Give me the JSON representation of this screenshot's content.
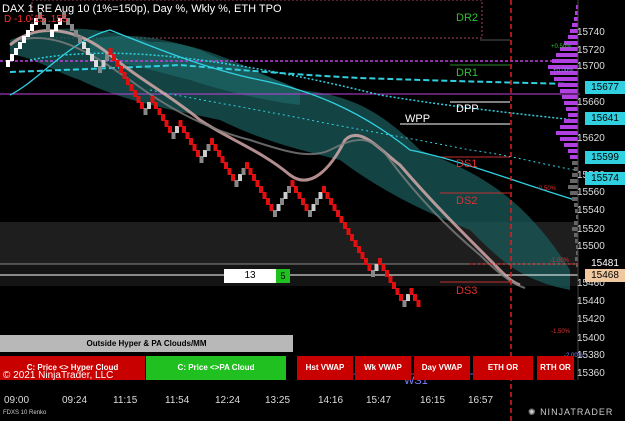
{
  "header": {
    "title": "DAX 1",
    "title_tail": "RE Aug 10 (1%=150p), Day %, Wkly %, ETH TPO",
    "sub": "D -1.0  15 .155"
  },
  "levels": {
    "dr2": "DR2",
    "dr1": "DR1",
    "dpp": "DPP",
    "wpp": "WPP",
    "ds1": "DS1",
    "ds2": "DS2",
    "ds3": "DS3",
    "ws1": "WS1"
  },
  "price_axis": {
    "ticks": [
      "15740",
      "15720",
      "15700",
      "15660",
      "15620",
      "15580",
      "15560",
      "15540",
      "15520",
      "15500",
      "15460",
      "15440",
      "15420",
      "15400",
      "15380",
      "15360"
    ],
    "boxes": [
      {
        "text": "15677",
        "bg": "#30d0e0",
        "fg": "#000"
      },
      {
        "text": "15641",
        "bg": "#30d0e0",
        "fg": "#000"
      },
      {
        "text": "15599",
        "bg": "#30d0e0",
        "fg": "#000"
      },
      {
        "text": "15574",
        "bg": "#30d0e0",
        "fg": "#000"
      },
      {
        "text": "15481",
        "bg": "#000",
        "fg": "#fff"
      },
      {
        "text": "15468",
        "bg": "#f0c8a0",
        "fg": "#000"
      }
    ],
    "pct_labels": [
      "+0.50%",
      "+0.00%",
      "-0.50%",
      "-1.00%",
      "-1.50%",
      "-2.00%"
    ]
  },
  "time_axis": [
    "09:00",
    "09:24",
    "11:15",
    "11:54",
    "12:24",
    "13:25",
    "14:16",
    "15:47",
    "16:15",
    "16:57"
  ],
  "counter": {
    "value": "13",
    "side": "5"
  },
  "footer": {
    "clouds_label": "Outside Hyper & PA Clouds/MM",
    "copyright": "© 2021 NinjaTrader, LLC",
    "instrument": "FDXS 10 Renko",
    "brand": "NINJATRADER"
  },
  "buttons": [
    {
      "label": "C: Price <> Hyper Cloud",
      "color": "#c80000"
    },
    {
      "label": "C: Price <>PA Cloud",
      "color": "#20c020"
    },
    {
      "label": "Hst VWAP",
      "color": "#c80000"
    },
    {
      "label": "Wk VWAP",
      "color": "#c80000"
    },
    {
      "label": "Day VWAP",
      "color": "#c80000"
    },
    {
      "label": "ETH OR",
      "color": "#c80000"
    },
    {
      "label": "RTH OR",
      "color": "#c80000"
    }
  ]
}
